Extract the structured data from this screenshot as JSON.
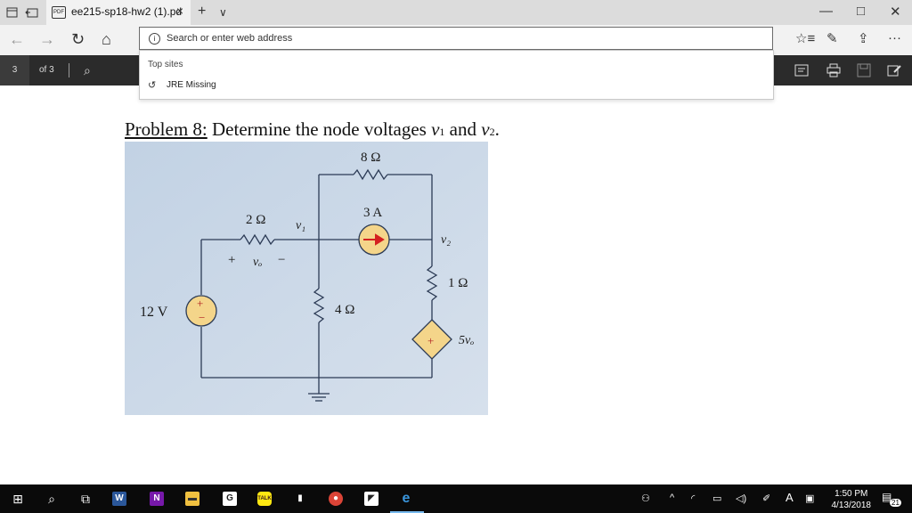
{
  "tab": {
    "title": "ee215-sp18-hw2 (1).pd",
    "close": "×",
    "new_tab": "+",
    "tab_list": "∨",
    "favicon_label": "PDF"
  },
  "window": {
    "minimize": "—",
    "restore": "□",
    "close": "✕"
  },
  "nav": {
    "back": "←",
    "forward": "→",
    "refresh": "↻",
    "home": "⌂"
  },
  "address": {
    "placeholder": "Search or enter web address",
    "value": ""
  },
  "nav_right": {
    "favorites": "☆≡",
    "notes": "✎",
    "share": "⇪",
    "more": "···"
  },
  "pdf": {
    "page_number": "3",
    "of_pages": "of 3",
    "search": "⌕"
  },
  "dropdown": {
    "header": "Top sites",
    "items": [
      {
        "label": "JRE Missing"
      }
    ]
  },
  "document": {
    "problem_label": "Problem 8:",
    "problem_text": " Determine the node voltages ",
    "v1": "v",
    "sub1": "1",
    "and": " and ",
    "v2": "v",
    "sub2": "2",
    "period": "."
  },
  "circuit": {
    "r_top": "8 Ω",
    "r_left": "2 Ω",
    "node1": "v₁",
    "current": "3 A",
    "node2": "v₂",
    "vo_plus": "+",
    "vo": "vₒ",
    "vo_minus": "−",
    "r_right": "1 Ω",
    "source_v": "12 V",
    "r_mid": "4 Ω",
    "dep_source": "5vₒ",
    "plus": "+",
    "minus": "−"
  },
  "taskbar": {
    "start": "⊞",
    "search": "⌕",
    "task_view": "⧉",
    "apps": [
      "Word",
      "OneNote",
      "File Explorer",
      "G",
      "KakaoTalk",
      "Phone",
      "Chrome",
      "Sticky",
      "Edge"
    ],
    "time": "1:50 PM",
    "date": "4/13/2018",
    "notifications": "21",
    "lang": "A"
  },
  "colors": {
    "tabstrip": "#dcdcdc",
    "pdfbar": "#2b2b2b",
    "taskbar": "#0a0a0a",
    "figure_bg": "#c9d6e6",
    "wire": "#2b3a55",
    "source_fill": "#f4d58a",
    "arrow": "#d42020"
  }
}
